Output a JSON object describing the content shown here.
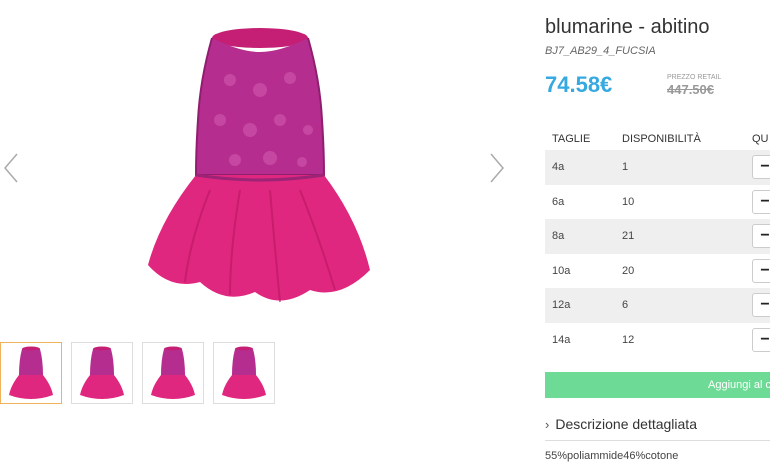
{
  "product": {
    "title": "blumarine - abitino",
    "sku": "BJ7_AB29_4_FUCSIA",
    "price": "74.58€",
    "retail_label": "PREZZO RETAIL",
    "retail_price": "447.50€"
  },
  "gallery": {
    "thumbnails": [
      {
        "name": "thumbnail-1",
        "active": true
      },
      {
        "name": "thumbnail-2",
        "active": false
      },
      {
        "name": "thumbnail-3",
        "active": false
      },
      {
        "name": "thumbnail-4",
        "active": false
      }
    ],
    "icons": {
      "prev": "chevron-left-icon",
      "next": "chevron-right-icon"
    }
  },
  "sizes_table": {
    "headers": {
      "size": "TAGLIE",
      "availability": "DISPONIBILITÀ",
      "quantity": "QU"
    },
    "rows": [
      {
        "size": "4a",
        "availability": "1",
        "qty_button": "−"
      },
      {
        "size": "6a",
        "availability": "10",
        "qty_button": "−"
      },
      {
        "size": "8a",
        "availability": "21",
        "qty_button": "−"
      },
      {
        "size": "10a",
        "availability": "20",
        "qty_button": "−"
      },
      {
        "size": "12a",
        "availability": "6",
        "qty_button": "−"
      },
      {
        "size": "14a",
        "availability": "12",
        "qty_button": "−"
      }
    ]
  },
  "cart": {
    "button_label": "Aggiungi al carrel"
  },
  "description": {
    "toggle_icon": "›",
    "toggle_label": "Descrizione dettagliata",
    "composition": "55%poliammide46%cotone"
  },
  "colors": {
    "price": "#36a9e0",
    "cart_button": "#6ddb95",
    "dress": "#c8207a",
    "active_thumb_border": "#f0b35c"
  }
}
